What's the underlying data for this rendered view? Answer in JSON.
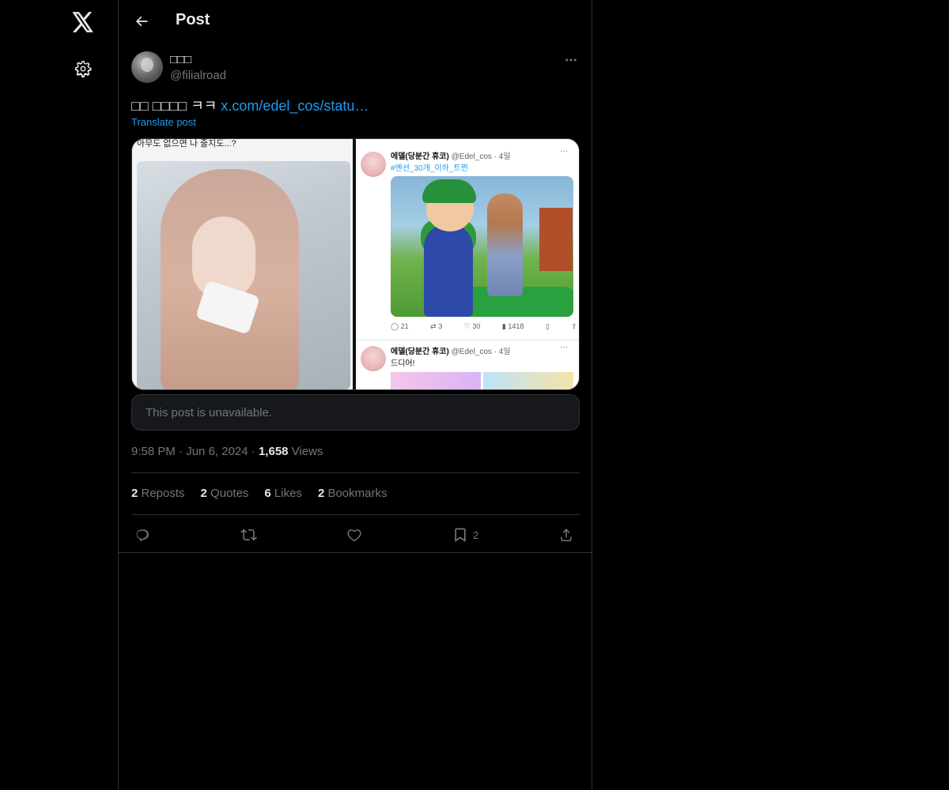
{
  "rail": {
    "logo_icon": "x-logo-icon",
    "settings_icon": "gear-icon"
  },
  "header": {
    "back_icon": "arrow-left-icon",
    "title": "Post"
  },
  "author": {
    "display_name": "□□□",
    "handle": "@filialroad",
    "more_icon": "more-horizontal-icon"
  },
  "post": {
    "text": "□□ □□□□ ㅋㅋ ",
    "link": "x.com/edel_cos/statu…",
    "translate_label": "Translate post"
  },
  "media": {
    "left_caption": "아무도 없으면 나 줄지도...?",
    "right_post1": {
      "name": "에델(당분간 휴코)",
      "handle": "@Edel_cos · 4일",
      "tag": "#멘션_30개_이하_트찐",
      "dots": "···",
      "stats": [
        "21",
        "3",
        "30",
        "1418"
      ]
    },
    "right_post2": {
      "name": "에델(당분간 휴코)",
      "handle": "@Edel_cos · 4일",
      "text": "드디어!",
      "dots": "···"
    }
  },
  "quoted": {
    "unavailable_text": "This post is unavailable."
  },
  "meta": {
    "time": "9:58 PM",
    "dot1": " · ",
    "date": "Jun 6, 2024",
    "dot2": " · ",
    "views_count": "1,658",
    "views_label": " Views"
  },
  "stats": {
    "reposts_count": "2",
    "reposts_label": " Reposts",
    "quotes_count": "2",
    "quotes_label": " Quotes",
    "likes_count": "6",
    "likes_label": " Likes",
    "bookmarks_count": "2",
    "bookmarks_label": " Bookmarks"
  },
  "actions": {
    "reply_icon": "reply-icon",
    "repost_icon": "repost-icon",
    "like_icon": "heart-icon",
    "bookmark_icon": "bookmark-icon",
    "bookmark_count": "2",
    "share_icon": "share-icon"
  },
  "colors": {
    "background": "#000000",
    "text": "#e7e9ea",
    "muted": "#71767b",
    "accent": "#1d9bf0",
    "border": "#2f3336"
  }
}
